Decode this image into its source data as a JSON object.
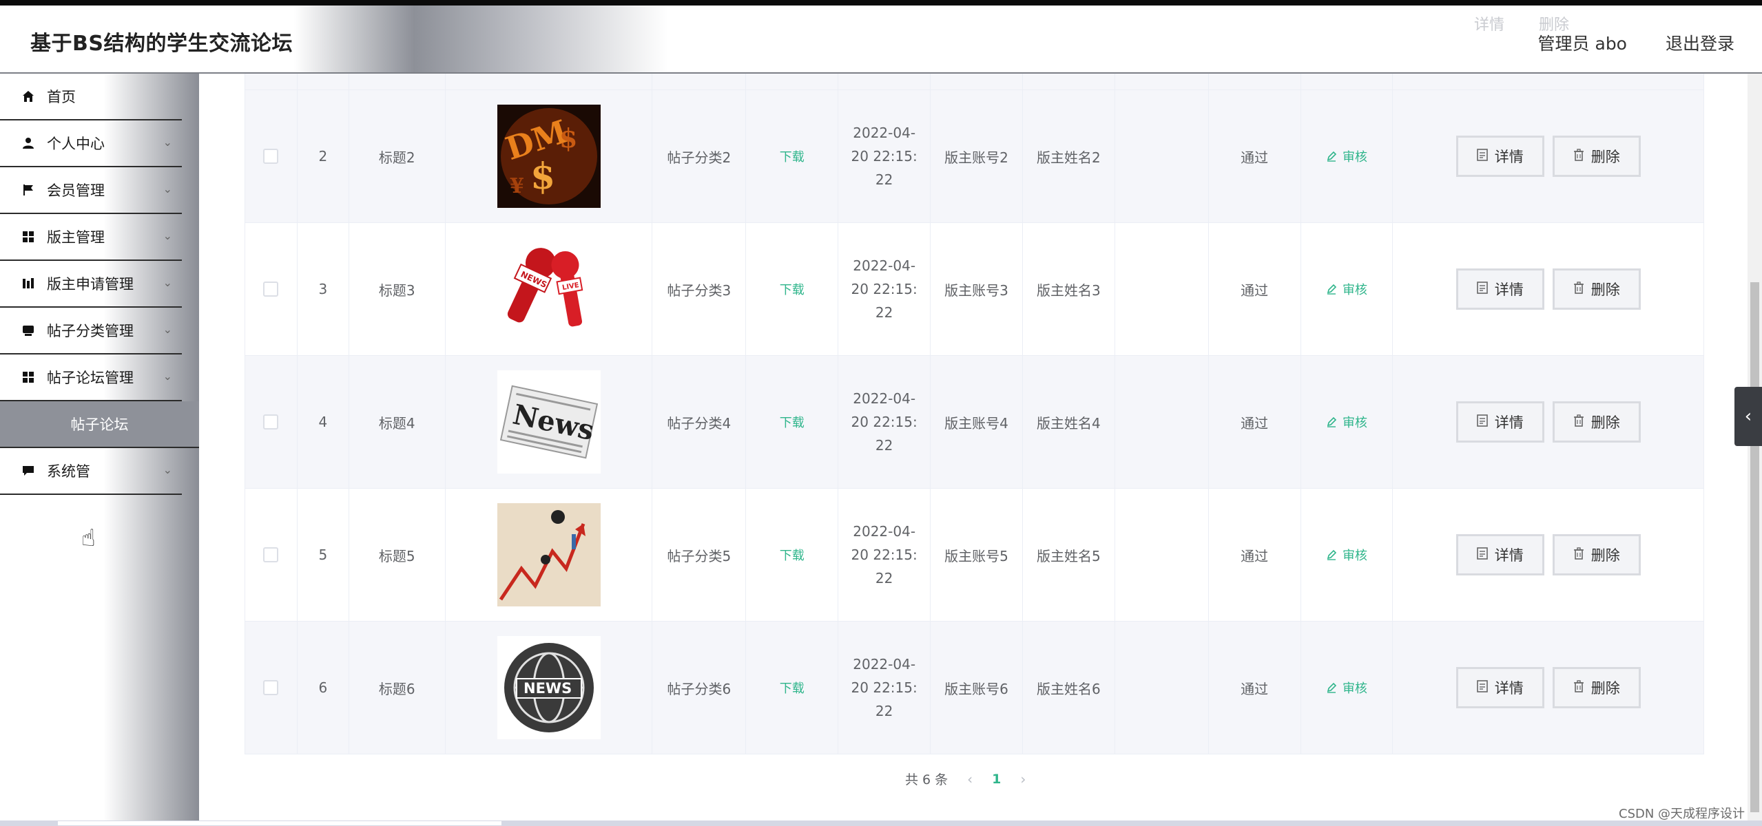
{
  "app": {
    "title": "基于BS结构的学生交流论坛"
  },
  "header": {
    "admin": "管理员 abo",
    "logout": "退出登录",
    "ghost_detail": "详情",
    "ghost_delete": "删除"
  },
  "sidebar": {
    "items": [
      {
        "label": "首页",
        "icon": "home-icon",
        "has_arrow": false
      },
      {
        "label": "个人中心",
        "icon": "user-icon",
        "has_arrow": true
      },
      {
        "label": "会员管理",
        "icon": "flag-icon",
        "has_arrow": true
      },
      {
        "label": "版主管理",
        "icon": "grid-icon",
        "has_arrow": true
      },
      {
        "label": "版主申请管理",
        "icon": "chart-icon",
        "has_arrow": true
      },
      {
        "label": "帖子分类管理",
        "icon": "card-icon",
        "has_arrow": true
      },
      {
        "label": "帖子论坛管理",
        "icon": "grid-icon",
        "has_arrow": true
      }
    ],
    "sub_item": "帖子论坛",
    "last_item": {
      "label": "系统管",
      "icon": "message-icon"
    }
  },
  "table": {
    "rows": [
      {
        "index": "2",
        "title": "标题2",
        "image": "dollar-sign-image",
        "category": "帖子分类2",
        "download": "下载",
        "time": [
          "2022-04-",
          "20 22:15:",
          "22"
        ],
        "account": "版主账号2",
        "name": "版主姓名2",
        "status": "通过",
        "audit": "审核"
      },
      {
        "index": "3",
        "title": "标题3",
        "image": "news-microphone-image",
        "category": "帖子分类3",
        "download": "下载",
        "time": [
          "2022-04-",
          "20 22:15:",
          "22"
        ],
        "account": "版主账号3",
        "name": "版主姓名3",
        "status": "通过",
        "audit": "审核"
      },
      {
        "index": "4",
        "title": "标题4",
        "image": "newspaper-image",
        "category": "帖子分类4",
        "download": "下载",
        "time": [
          "2022-04-",
          "20 22:15:",
          "22"
        ],
        "account": "版主账号4",
        "name": "版主姓名4",
        "status": "通过",
        "audit": "审核"
      },
      {
        "index": "5",
        "title": "标题5",
        "image": "stock-chart-image",
        "category": "帖子分类5",
        "download": "下载",
        "time": [
          "2022-04-",
          "20 22:15:",
          "22"
        ],
        "account": "版主账号5",
        "name": "版主姓名5",
        "status": "通过",
        "audit": "审核"
      },
      {
        "index": "6",
        "title": "标题6",
        "image": "news-globe-image",
        "category": "帖子分类6",
        "download": "下载",
        "time": [
          "2022-04-",
          "20 22:15:",
          "22"
        ],
        "account": "版主账号6",
        "name": "版主姓名6",
        "status": "通过",
        "audit": "审核"
      }
    ],
    "detail_label": "详情",
    "delete_label": "删除"
  },
  "pagination": {
    "total": "共 6 条",
    "current_page": "1"
  },
  "watermark": "CSDN @天成程序设计",
  "colors": {
    "accent": "#2fb58b",
    "sidebar_sub": "#8e9199",
    "row_stripe": "#f5f6fa"
  }
}
